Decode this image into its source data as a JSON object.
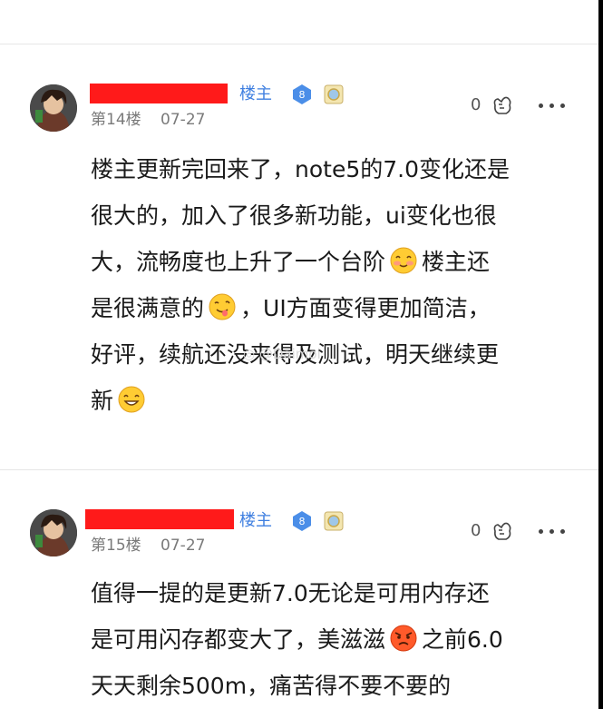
{
  "posts": [
    {
      "owner_label": "楼主",
      "level": "8",
      "floor": "第14楼",
      "date": "07-27",
      "likes": "0",
      "lines": [
        "楼主更新完回来了，note5的7.0变化还是",
        "很大的，加入了很多新功能，ui变化也很",
        "大，流畅度也上升了一个台阶",
        "楼主还",
        "是很满意的",
        "，UI方面变得更加简洁，",
        "好评，续航还没来得及测试，明天继续更",
        "新"
      ]
    },
    {
      "owner_label": "楼主",
      "level": "8",
      "floor": "第15楼",
      "date": "07-27",
      "likes": "0",
      "lines": [
        "值得一提的是更新7.0无论是可用内存还",
        "是可用闪存都变大了，美滋滋",
        "之前6.0",
        "天天剩余500m，痛苦得不要不要的"
      ]
    }
  ],
  "watermark": "@Daimoi",
  "colors": {
    "owner_label": "#3f7fe0",
    "redaction": "#ff1a1a",
    "meta_text": "#7a7a7a"
  },
  "icons": [
    "avatar",
    "level-badge-icon",
    "medal-icon",
    "like-hand-icon",
    "more-icon",
    "emoji-icon",
    "weibo-icon"
  ]
}
